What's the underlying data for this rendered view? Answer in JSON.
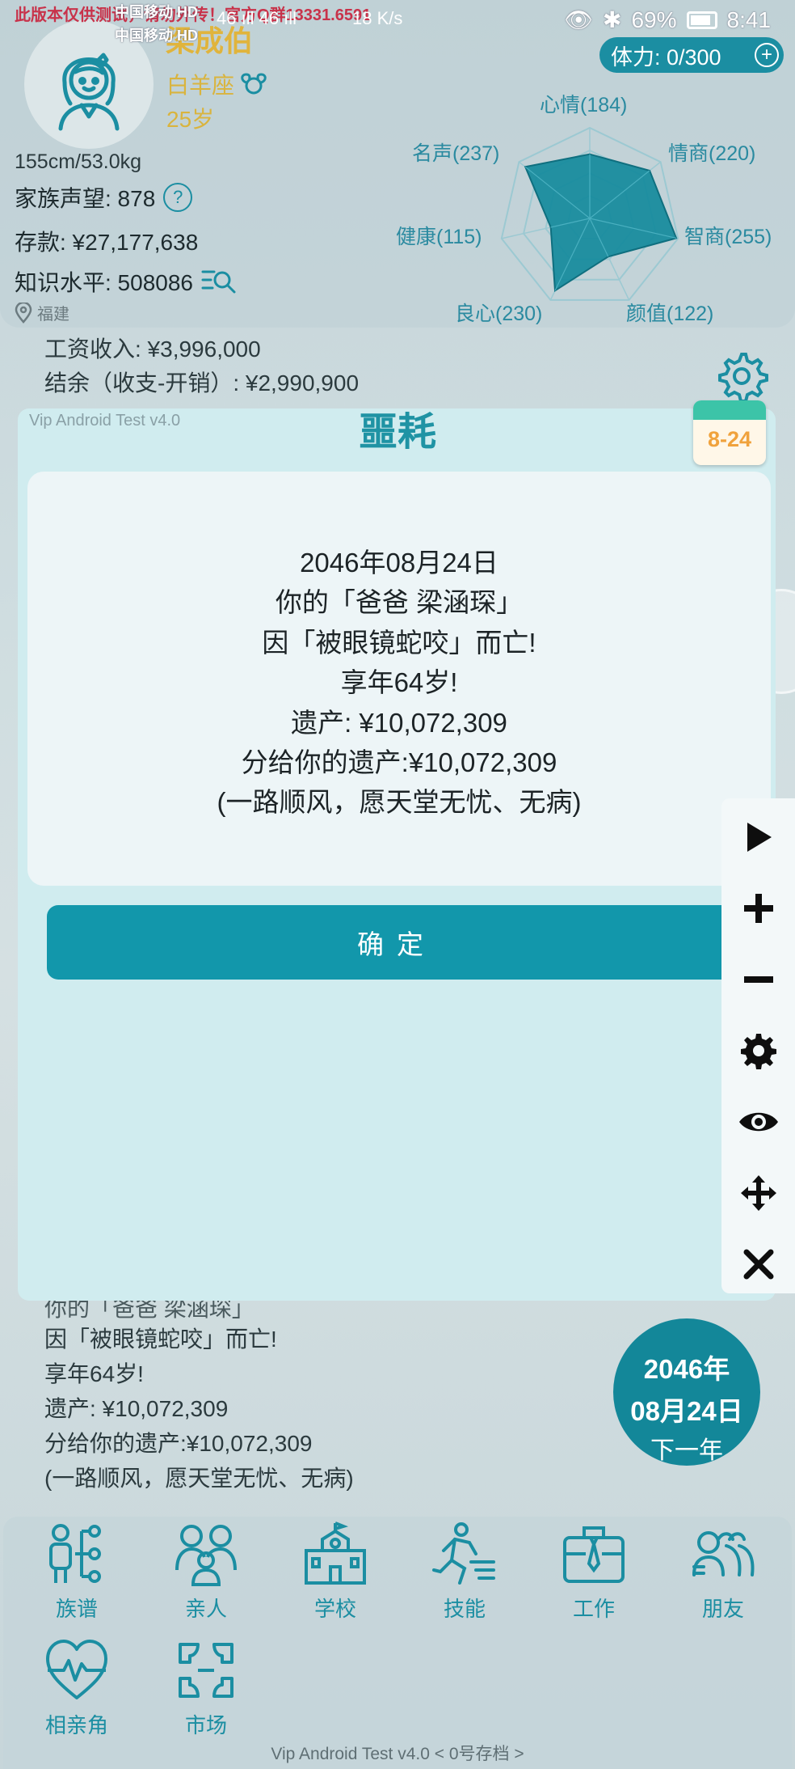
{
  "status_bar": {
    "notice": "此版本仅供测试，请勿外传！官方Q群1333",
    "notice_tail": "1.6591",
    "carrier1": "中国移动 HD",
    "carrier2": "中国移动 HD",
    "signal": "46 ıll 46 ıll",
    "speed": "18 K/s",
    "battery": "69%",
    "time": "8:41"
  },
  "profile": {
    "name": "梁成伯",
    "zodiac": "白羊座",
    "age": "25岁",
    "height_weight": "155cm/53.0kg",
    "family_reputation": "家族声望: 878",
    "savings": "存款: ¥27,177,638",
    "knowledge": "知识水平: 508086",
    "location": "福建",
    "stamina": "体力: 0/300"
  },
  "radar": {
    "labels": {
      "mood": "心情(184)",
      "eq": "情商(220)",
      "iq": "智商(255)",
      "looks": "颜值(122)",
      "conscience": "良心(230)",
      "health": "健康(115)",
      "fame": "名声(237)"
    },
    "stats": [
      {
        "name": "心情",
        "value": 184
      },
      {
        "name": "情商",
        "value": 220
      },
      {
        "name": "智商",
        "value": 255
      },
      {
        "name": "颜值",
        "value": 122
      },
      {
        "name": "良心",
        "value": 230
      },
      {
        "name": "健康",
        "value": 115
      },
      {
        "name": "名声",
        "value": 237
      }
    ],
    "fill_color": "#158a9c"
  },
  "background_log": {
    "salary": "工资收入: ¥3,996,000",
    "balance": "结余（收支-开销）: ¥2,990,900",
    "lines": [
      "你的「爸爸 梁涵琛」",
      "因「被眼镜蛇咬」而亡!",
      "享年64岁!",
      "遗产: ¥10,072,309",
      "分给你的遗产:¥10,072,309",
      "(一路顺风，愿天堂无忧、无病)"
    ]
  },
  "modal": {
    "version": "Vip Android Test v4.0",
    "title": "噩耗",
    "lines": [
      "2046年08月24日",
      "你的「爸爸 梁涵琛」",
      "因「被眼镜蛇咬」而亡!",
      "享年64岁!",
      "遗产: ¥10,072,309",
      "分给你的遗产:¥10,072,309",
      "(一路顺风，愿天堂无忧、无病)"
    ],
    "confirm": "确定"
  },
  "date_badge": "8-24",
  "side_toolbar": {
    "icons": [
      "play-icon",
      "plus-icon",
      "minus-icon",
      "gear-icon",
      "eye-icon",
      "move-icon",
      "close-icon"
    ]
  },
  "year_button": {
    "year": "2046年",
    "date": "08月24日",
    "action": "下一年"
  },
  "nav": {
    "items": [
      "族谱",
      "亲人",
      "学校",
      "技能",
      "工作",
      "朋友",
      "相亲角",
      "市场"
    ]
  },
  "footer": "Vip Android Test v4.0  < 0号存档 >",
  "colors": {
    "accent": "#1297ab",
    "gold": "#e0b43c",
    "modal_bg": "#d0ecef"
  }
}
